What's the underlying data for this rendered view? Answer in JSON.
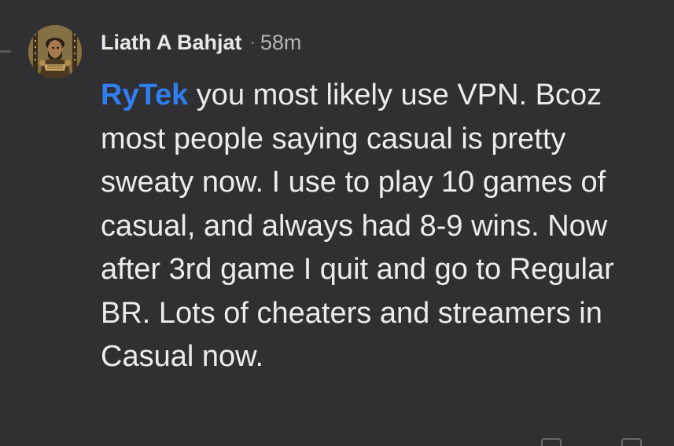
{
  "comment": {
    "author": "Liath A Bahjat",
    "separator": "·",
    "timestamp": "58m",
    "mention": "RyTek",
    "body": " you most likely use VPN. Bcoz most people saying casual is pretty sweaty now. I use to play 10 games of casual, and always had 8-9 wins. Now after 3rd game I quit and go to Regular BR. Lots of cheaters and streamers in Casual now."
  },
  "colors": {
    "background": "#303032",
    "author_text": "#e8e8e8",
    "body_text": "#ececec",
    "mention": "#2f7ff3",
    "timestamp": "#b4b4b4"
  },
  "icons": {
    "avatar": "user-avatar-warrior-portrait",
    "thread": "thread-connector-line"
  }
}
